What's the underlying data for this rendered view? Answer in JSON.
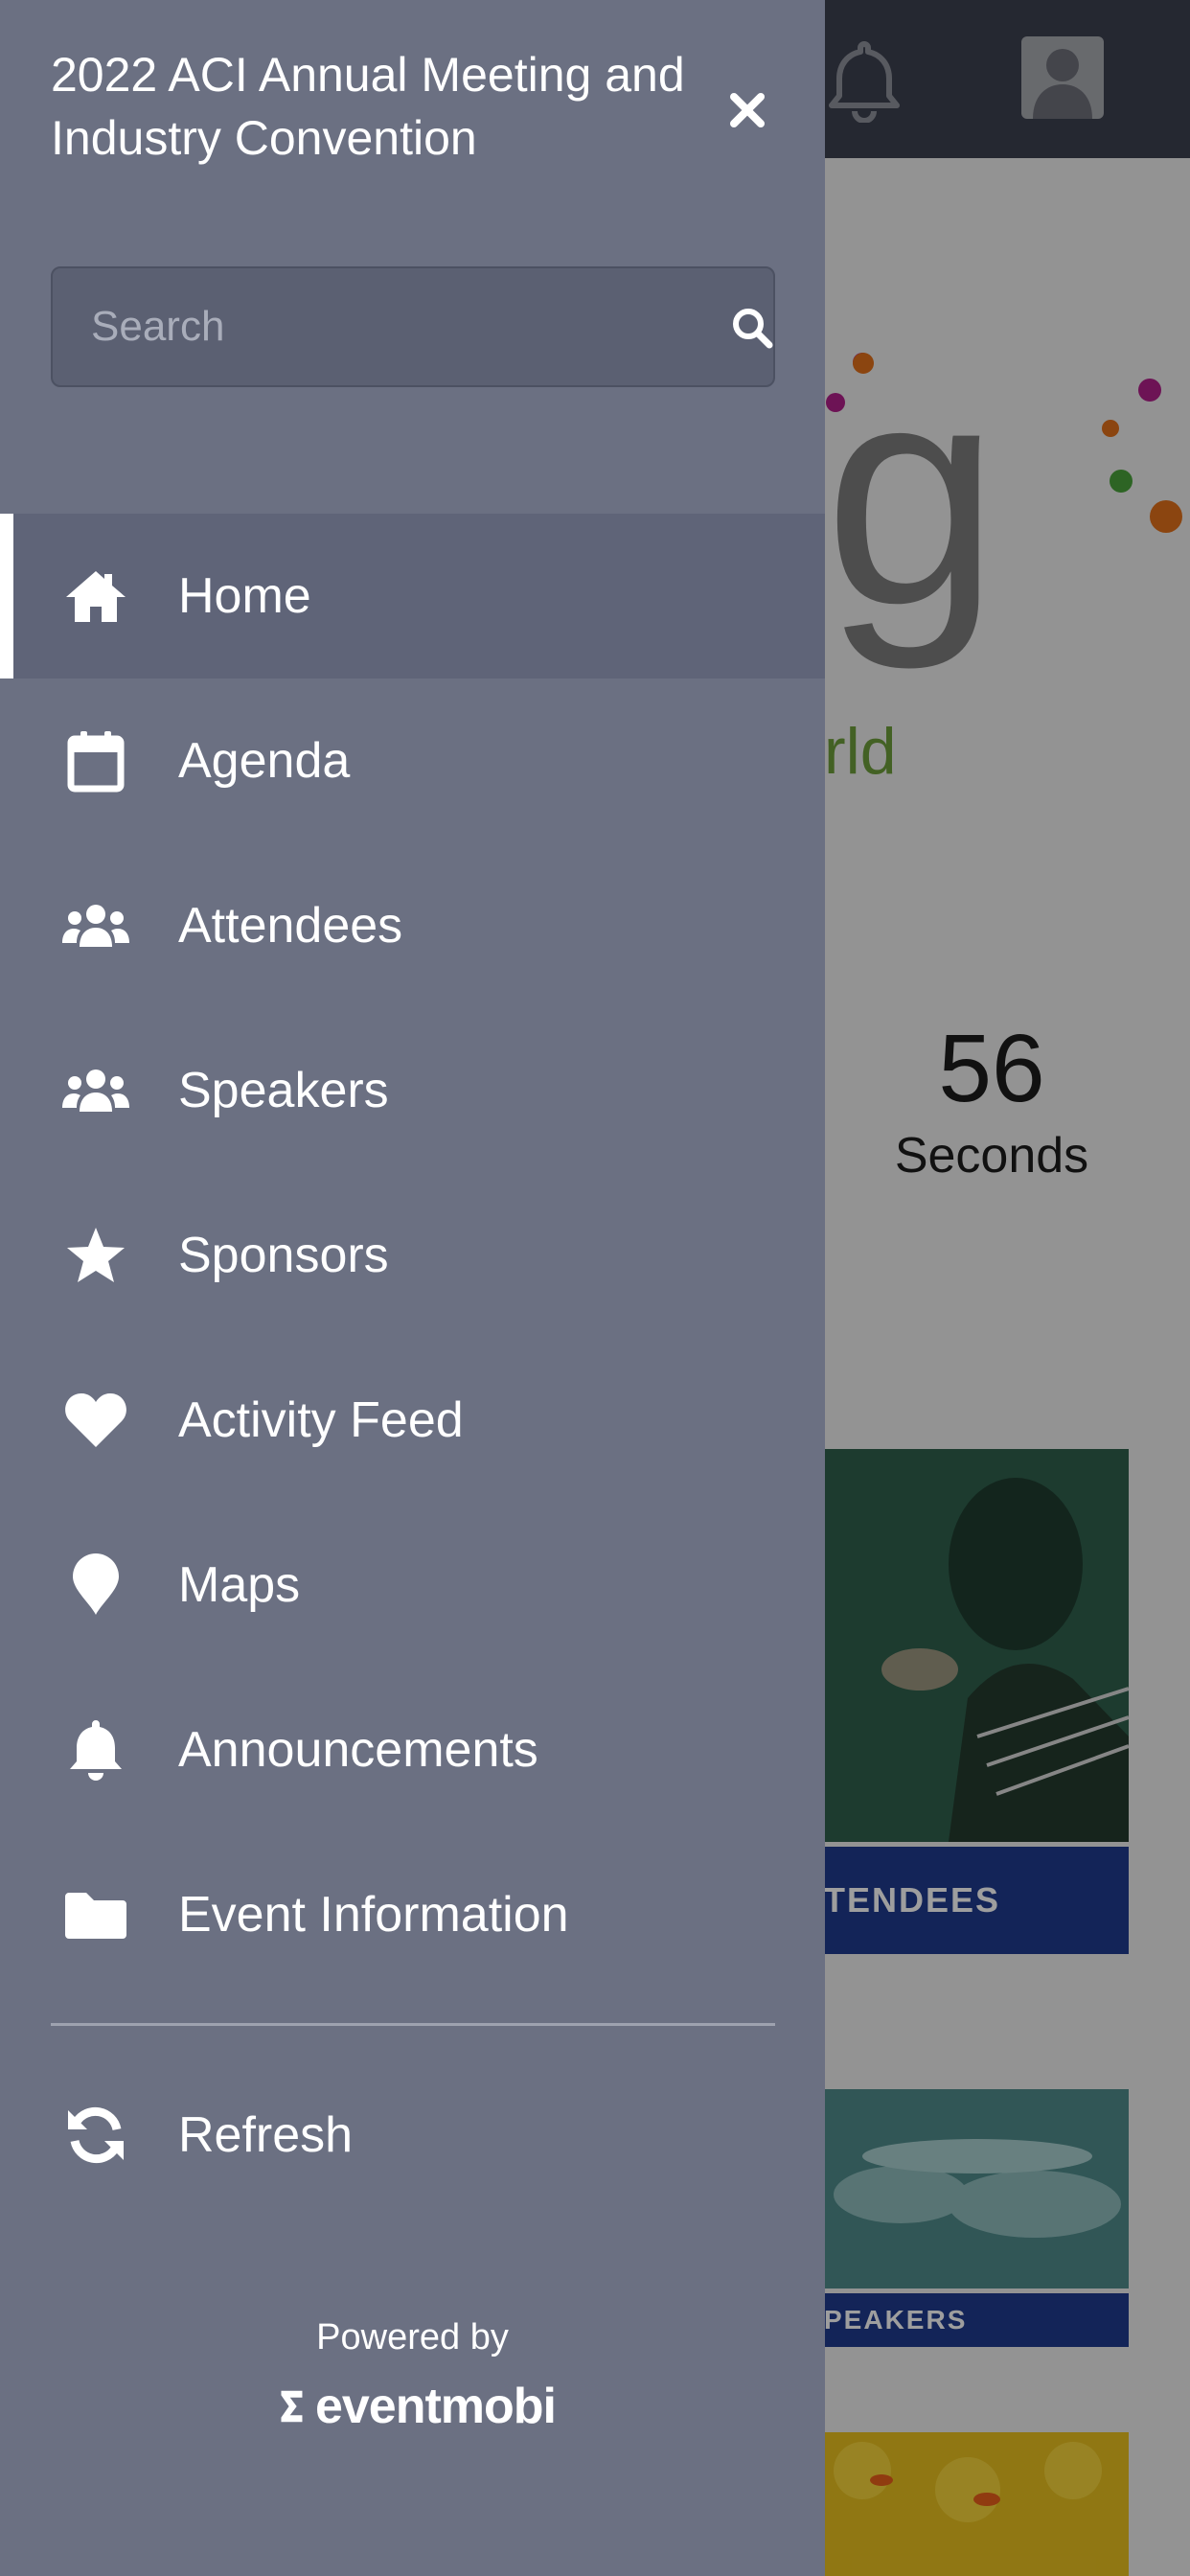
{
  "drawer": {
    "title": "2022 ACI Annual Meeting and Industry Convention",
    "search_placeholder": "Search",
    "items": [
      {
        "label": "Home",
        "icon": "home-icon",
        "active": true
      },
      {
        "label": "Agenda",
        "icon": "calendar-icon",
        "active": false
      },
      {
        "label": "Attendees",
        "icon": "users-icon",
        "active": false
      },
      {
        "label": "Speakers",
        "icon": "users-icon",
        "active": false
      },
      {
        "label": "Sponsors",
        "icon": "star-icon",
        "active": false
      },
      {
        "label": "Activity Feed",
        "icon": "heart-icon",
        "active": false
      },
      {
        "label": "Maps",
        "icon": "map-pin-icon",
        "active": false
      },
      {
        "label": "Announcements",
        "icon": "bell-icon",
        "active": false
      },
      {
        "label": "Event Information",
        "icon": "folder-icon",
        "active": false
      }
    ],
    "refresh_label": "Refresh",
    "powered_by": "Powered by",
    "brand_name": "eventmobi"
  },
  "background": {
    "logo_letter": "g",
    "logo_subtext": "rld",
    "countdown_value": "56",
    "countdown_unit": "Seconds",
    "tile_attendees_label": "TENDEES",
    "tile_speakers_label": "PEAKERS"
  },
  "colors": {
    "drawer_bg": "#6b7082",
    "active_item_bg": "#5f6478",
    "topbar_bg": "#3d4150",
    "tile_bar": "#1f3a8e"
  }
}
